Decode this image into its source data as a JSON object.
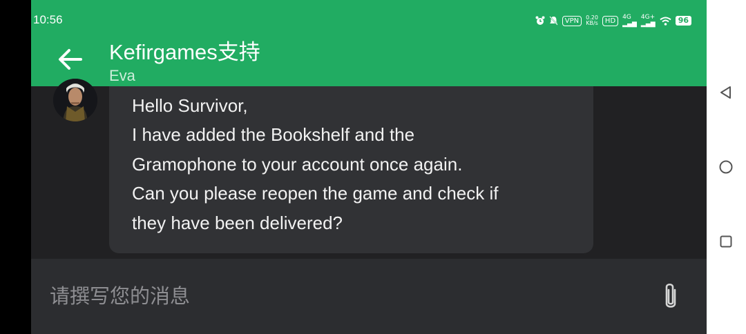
{
  "status_bar": {
    "time": "10:56",
    "vpn": "VPN",
    "speed_value": "0.20",
    "speed_unit": "KB/s",
    "hd": "HD",
    "net1": "4G",
    "net2": "4G+",
    "battery": "96",
    "icons": [
      "alarm-icon",
      "mute-icon",
      "vpn-icon",
      "hd-icon",
      "signal-icon",
      "signal-icon",
      "wifi-icon",
      "battery-icon"
    ]
  },
  "header": {
    "title": "Kefirgames支持",
    "subtitle": "Eva",
    "color": "#21ac62"
  },
  "message": {
    "lines": [
      "Hello Survivor,",
      "I have added the Bookshelf and the",
      "Gramophone to your account once again.",
      "Can you please reopen the game and check if",
      "they have been delivered?"
    ]
  },
  "composer": {
    "placeholder": "请撰写您的消息"
  },
  "navigation": {
    "icons": [
      "back-triangle-icon",
      "home-circle-icon",
      "recents-square-icon"
    ]
  }
}
